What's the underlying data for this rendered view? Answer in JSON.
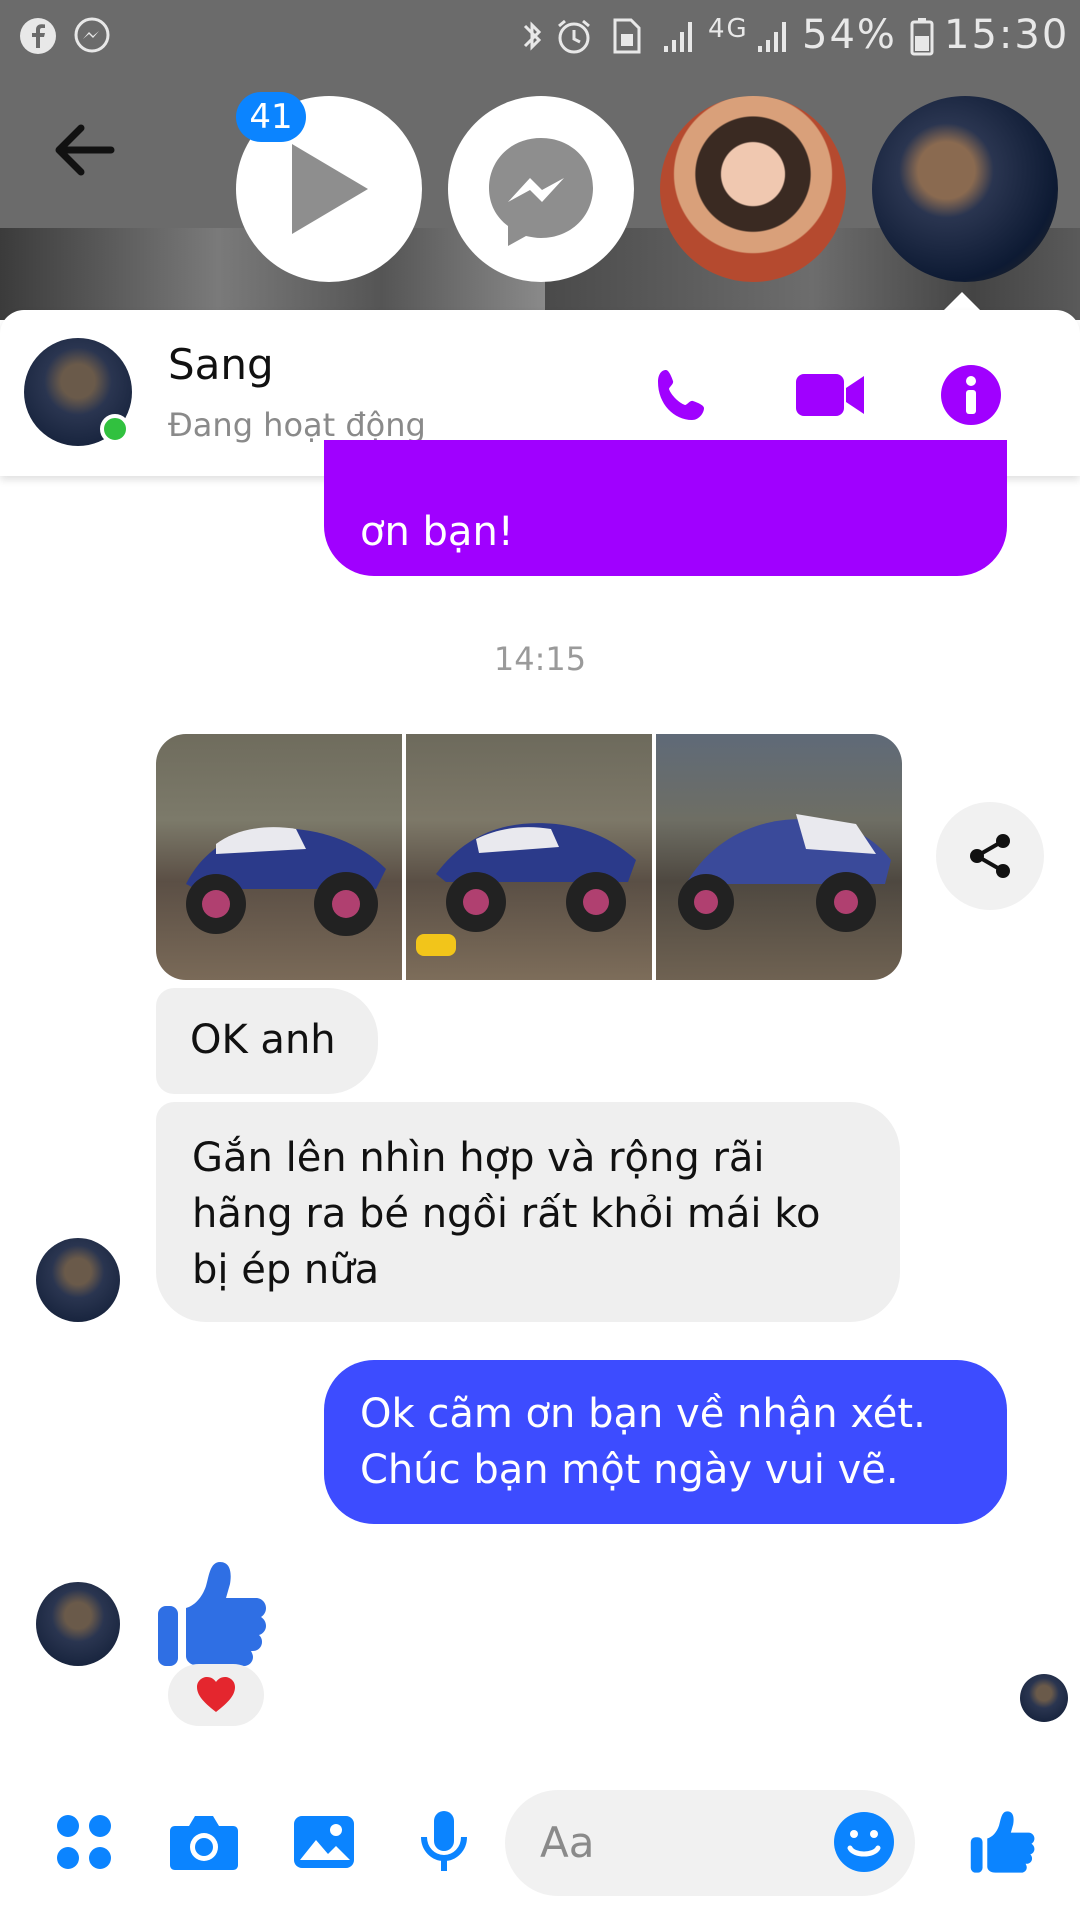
{
  "statusbar": {
    "battery": "54%",
    "time": "15:30",
    "network": "4G"
  },
  "chatheads": {
    "badge_count": "41"
  },
  "header": {
    "name": "Sang",
    "status": "Đang hoạt động"
  },
  "messages": {
    "outgoing_1_partial": "ơn bạn!",
    "timestamp": "14:15",
    "incoming_1": "OK anh",
    "incoming_2": "Gắn lên nhìn hợp và rộng rãi hãng ra bé ngồi rất khỏi mái ko bị ép nữa",
    "outgoing_2": "Ok cãm ơn bạn về nhận xét. Chúc bạn một ngày vui vẽ.",
    "reaction": "❤️"
  },
  "composer": {
    "placeholder": "Aa"
  },
  "colors": {
    "accent_purple": "#a000ff",
    "bubble_blue": "#3d4cff",
    "messenger_blue": "#0b84ff",
    "online_green": "#31c13f"
  }
}
